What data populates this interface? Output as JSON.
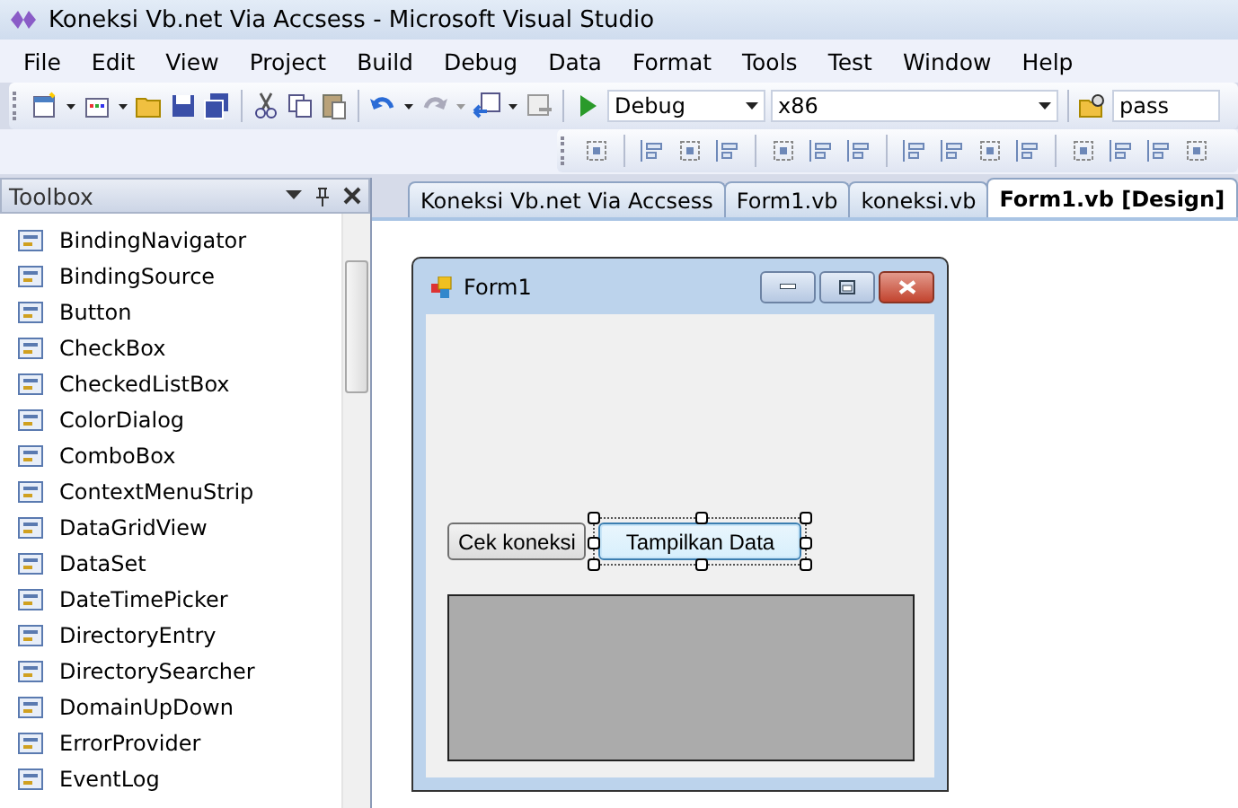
{
  "window": {
    "title": "Koneksi Vb.net Via Accsess - Microsoft Visual Studio"
  },
  "menu": [
    "File",
    "Edit",
    "View",
    "Project",
    "Build",
    "Debug",
    "Data",
    "Format",
    "Tools",
    "Test",
    "Window",
    "Help"
  ],
  "toolbar": {
    "configuration": "Debug",
    "platform": "x86",
    "search": "pass"
  },
  "toolbox": {
    "title": "Toolbox",
    "items": [
      "BindingNavigator",
      "BindingSource",
      "Button",
      "CheckBox",
      "CheckedListBox",
      "ColorDialog",
      "ComboBox",
      "ContextMenuStrip",
      "DataGridView",
      "DataSet",
      "DateTimePicker",
      "DirectoryEntry",
      "DirectorySearcher",
      "DomainUpDown",
      "ErrorProvider",
      "EventLog"
    ]
  },
  "tabs": [
    {
      "label": "Koneksi Vb.net Via Accsess",
      "selected": false
    },
    {
      "label": "Form1.vb",
      "selected": false
    },
    {
      "label": "koneksi.vb",
      "selected": false
    },
    {
      "label": "Form1.vb [Design]",
      "selected": true
    }
  ],
  "form": {
    "title": "Form1",
    "buttons": [
      {
        "label": "Cek koneksi",
        "selected": false
      },
      {
        "label": "Tampilkan Data",
        "selected": true
      }
    ]
  }
}
